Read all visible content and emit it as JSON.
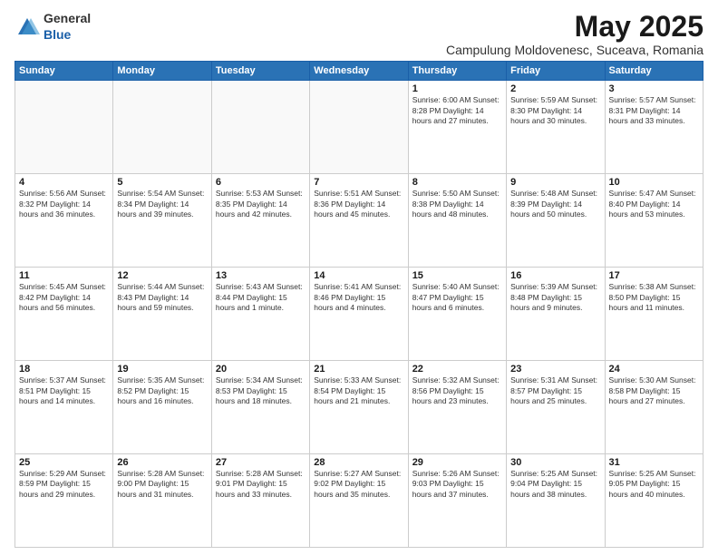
{
  "header": {
    "logo_general": "General",
    "logo_blue": "Blue",
    "title": "May 2025",
    "subtitle": "Campulung Moldovenesc, Suceava, Romania"
  },
  "days_of_week": [
    "Sunday",
    "Monday",
    "Tuesday",
    "Wednesday",
    "Thursday",
    "Friday",
    "Saturday"
  ],
  "weeks": [
    [
      {
        "day": "",
        "info": ""
      },
      {
        "day": "",
        "info": ""
      },
      {
        "day": "",
        "info": ""
      },
      {
        "day": "",
        "info": ""
      },
      {
        "day": "1",
        "info": "Sunrise: 6:00 AM\nSunset: 8:28 PM\nDaylight: 14 hours\nand 27 minutes."
      },
      {
        "day": "2",
        "info": "Sunrise: 5:59 AM\nSunset: 8:30 PM\nDaylight: 14 hours\nand 30 minutes."
      },
      {
        "day": "3",
        "info": "Sunrise: 5:57 AM\nSunset: 8:31 PM\nDaylight: 14 hours\nand 33 minutes."
      }
    ],
    [
      {
        "day": "4",
        "info": "Sunrise: 5:56 AM\nSunset: 8:32 PM\nDaylight: 14 hours\nand 36 minutes."
      },
      {
        "day": "5",
        "info": "Sunrise: 5:54 AM\nSunset: 8:34 PM\nDaylight: 14 hours\nand 39 minutes."
      },
      {
        "day": "6",
        "info": "Sunrise: 5:53 AM\nSunset: 8:35 PM\nDaylight: 14 hours\nand 42 minutes."
      },
      {
        "day": "7",
        "info": "Sunrise: 5:51 AM\nSunset: 8:36 PM\nDaylight: 14 hours\nand 45 minutes."
      },
      {
        "day": "8",
        "info": "Sunrise: 5:50 AM\nSunset: 8:38 PM\nDaylight: 14 hours\nand 48 minutes."
      },
      {
        "day": "9",
        "info": "Sunrise: 5:48 AM\nSunset: 8:39 PM\nDaylight: 14 hours\nand 50 minutes."
      },
      {
        "day": "10",
        "info": "Sunrise: 5:47 AM\nSunset: 8:40 PM\nDaylight: 14 hours\nand 53 minutes."
      }
    ],
    [
      {
        "day": "11",
        "info": "Sunrise: 5:45 AM\nSunset: 8:42 PM\nDaylight: 14 hours\nand 56 minutes."
      },
      {
        "day": "12",
        "info": "Sunrise: 5:44 AM\nSunset: 8:43 PM\nDaylight: 14 hours\nand 59 minutes."
      },
      {
        "day": "13",
        "info": "Sunrise: 5:43 AM\nSunset: 8:44 PM\nDaylight: 15 hours\nand 1 minute."
      },
      {
        "day": "14",
        "info": "Sunrise: 5:41 AM\nSunset: 8:46 PM\nDaylight: 15 hours\nand 4 minutes."
      },
      {
        "day": "15",
        "info": "Sunrise: 5:40 AM\nSunset: 8:47 PM\nDaylight: 15 hours\nand 6 minutes."
      },
      {
        "day": "16",
        "info": "Sunrise: 5:39 AM\nSunset: 8:48 PM\nDaylight: 15 hours\nand 9 minutes."
      },
      {
        "day": "17",
        "info": "Sunrise: 5:38 AM\nSunset: 8:50 PM\nDaylight: 15 hours\nand 11 minutes."
      }
    ],
    [
      {
        "day": "18",
        "info": "Sunrise: 5:37 AM\nSunset: 8:51 PM\nDaylight: 15 hours\nand 14 minutes."
      },
      {
        "day": "19",
        "info": "Sunrise: 5:35 AM\nSunset: 8:52 PM\nDaylight: 15 hours\nand 16 minutes."
      },
      {
        "day": "20",
        "info": "Sunrise: 5:34 AM\nSunset: 8:53 PM\nDaylight: 15 hours\nand 18 minutes."
      },
      {
        "day": "21",
        "info": "Sunrise: 5:33 AM\nSunset: 8:54 PM\nDaylight: 15 hours\nand 21 minutes."
      },
      {
        "day": "22",
        "info": "Sunrise: 5:32 AM\nSunset: 8:56 PM\nDaylight: 15 hours\nand 23 minutes."
      },
      {
        "day": "23",
        "info": "Sunrise: 5:31 AM\nSunset: 8:57 PM\nDaylight: 15 hours\nand 25 minutes."
      },
      {
        "day": "24",
        "info": "Sunrise: 5:30 AM\nSunset: 8:58 PM\nDaylight: 15 hours\nand 27 minutes."
      }
    ],
    [
      {
        "day": "25",
        "info": "Sunrise: 5:29 AM\nSunset: 8:59 PM\nDaylight: 15 hours\nand 29 minutes."
      },
      {
        "day": "26",
        "info": "Sunrise: 5:28 AM\nSunset: 9:00 PM\nDaylight: 15 hours\nand 31 minutes."
      },
      {
        "day": "27",
        "info": "Sunrise: 5:28 AM\nSunset: 9:01 PM\nDaylight: 15 hours\nand 33 minutes."
      },
      {
        "day": "28",
        "info": "Sunrise: 5:27 AM\nSunset: 9:02 PM\nDaylight: 15 hours\nand 35 minutes."
      },
      {
        "day": "29",
        "info": "Sunrise: 5:26 AM\nSunset: 9:03 PM\nDaylight: 15 hours\nand 37 minutes."
      },
      {
        "day": "30",
        "info": "Sunrise: 5:25 AM\nSunset: 9:04 PM\nDaylight: 15 hours\nand 38 minutes."
      },
      {
        "day": "31",
        "info": "Sunrise: 5:25 AM\nSunset: 9:05 PM\nDaylight: 15 hours\nand 40 minutes."
      }
    ]
  ]
}
